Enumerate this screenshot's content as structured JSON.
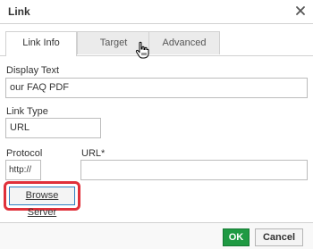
{
  "dialog": {
    "title": "Link",
    "close_icon": "close-icon"
  },
  "tabs": [
    {
      "label": "Link Info",
      "active": true
    },
    {
      "label": "Target",
      "active": false
    },
    {
      "label": "Advanced",
      "active": false
    }
  ],
  "form": {
    "display_text_label": "Display Text",
    "display_text_value": "our FAQ PDF",
    "link_type_label": "Link Type",
    "link_type_value": "URL",
    "protocol_label": "Protocol",
    "protocol_value": "http://",
    "url_label": "URL*",
    "url_value": ""
  },
  "browse_button": {
    "label": "Browse Server",
    "highlight_color": "#e0303a"
  },
  "footer": {
    "ok_label": "OK",
    "cancel_label": "Cancel",
    "ok_color": "#1f9a43"
  },
  "cursor_icon": "hand-pointer-icon"
}
